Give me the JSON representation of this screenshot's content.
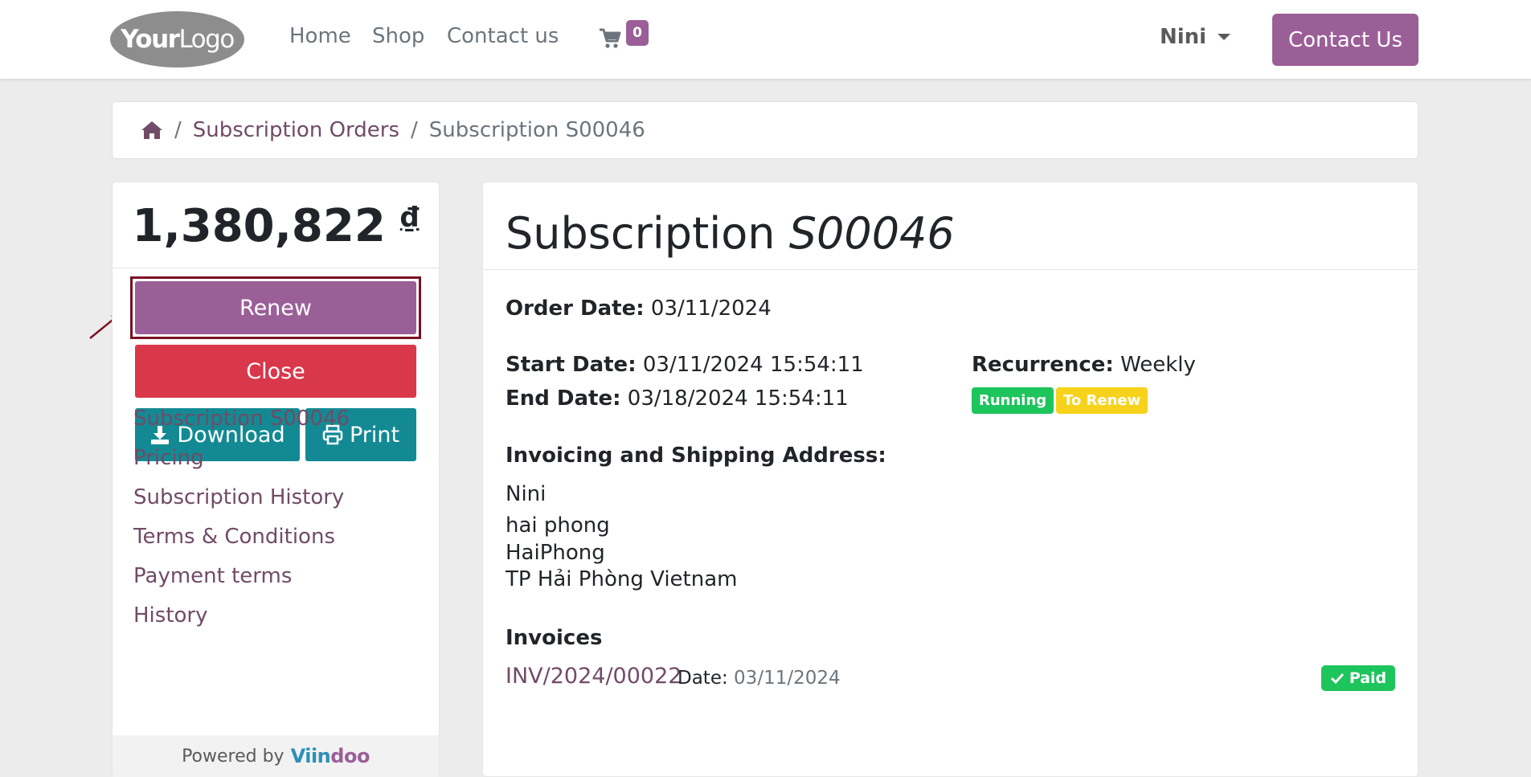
{
  "header": {
    "logo_bold": "Your",
    "logo_light": "Logo",
    "nav": [
      "Home",
      "Shop",
      "Contact us"
    ],
    "cart_count": "0",
    "user_name": "Nini",
    "contact_button": "Contact Us"
  },
  "breadcrumb": {
    "home_icon": "home-icon",
    "items": [
      "Subscription Orders",
      "Subscription S00046"
    ],
    "separator": "/"
  },
  "sidebar": {
    "amount": "1,380,822",
    "currency": "₫",
    "buttons": {
      "renew": "Renew",
      "close": "Close",
      "download": "Download",
      "print": "Print"
    },
    "links": [
      "Subscription S00046",
      "Pricing",
      "Subscription History",
      "Terms & Conditions",
      "Payment terms",
      "History"
    ],
    "powered_by": "Powered by",
    "brand_a": "Viin",
    "brand_b": "doo"
  },
  "main": {
    "title_prefix": "Subscription",
    "title_ref": "S00046",
    "order_date_label": "Order Date:",
    "order_date": "03/11/2024",
    "start_date_label": "Start Date:",
    "start_date": "03/11/2024 15:54:11",
    "end_date_label": "End Date:",
    "end_date": "03/18/2024 15:54:11",
    "recurrence_label": "Recurrence:",
    "recurrence": "Weekly",
    "badges": [
      "Running",
      "To Renew"
    ],
    "address_heading": "Invoicing and Shipping Address:",
    "address": [
      "Nini",
      "hai phong",
      "HaiPhong",
      "TP Hải Phòng Vietnam"
    ],
    "invoices_heading": "Invoices",
    "invoice": {
      "number": "INV/2024/00022",
      "date_label": "Date:",
      "date": "03/11/2024",
      "status": "Paid"
    }
  },
  "colors": {
    "primary": "#9b5f98",
    "link": "#714b67",
    "danger": "#d9384a",
    "info": "#138a93",
    "success": "#1ec45c",
    "warning": "#f7d21a"
  }
}
